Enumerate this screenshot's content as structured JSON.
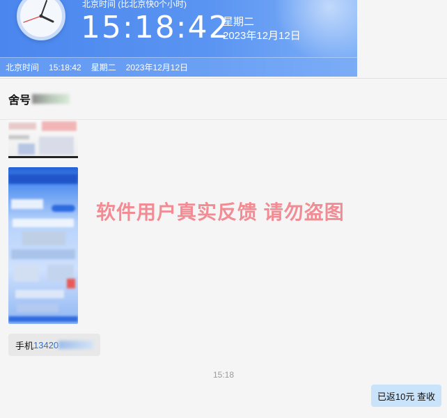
{
  "clock": {
    "subtitle": "北京时间 (比北京快0个小时)",
    "time": "15:18:42",
    "weekday": "星期二",
    "date": "2023年12月12日",
    "bar": {
      "label": "北京时间",
      "time": "15:18:42",
      "weekday": "星期二",
      "date": "2023年12月12日"
    }
  },
  "chat": {
    "title": "舍号",
    "watermark": "软件用户真实反馈  请勿盗图",
    "messages": {
      "phone_prefix": "手机",
      "phone_visible": "13420",
      "timestamp": "15:18",
      "reply": "已返10元 查收"
    }
  },
  "colors": {
    "clock_bg": "#4a86ee",
    "watermark": "#f06e78",
    "reply_bubble": "#c9e3fb",
    "incoming_bubble": "#e8e8e8",
    "link": "#2a6fd6"
  }
}
